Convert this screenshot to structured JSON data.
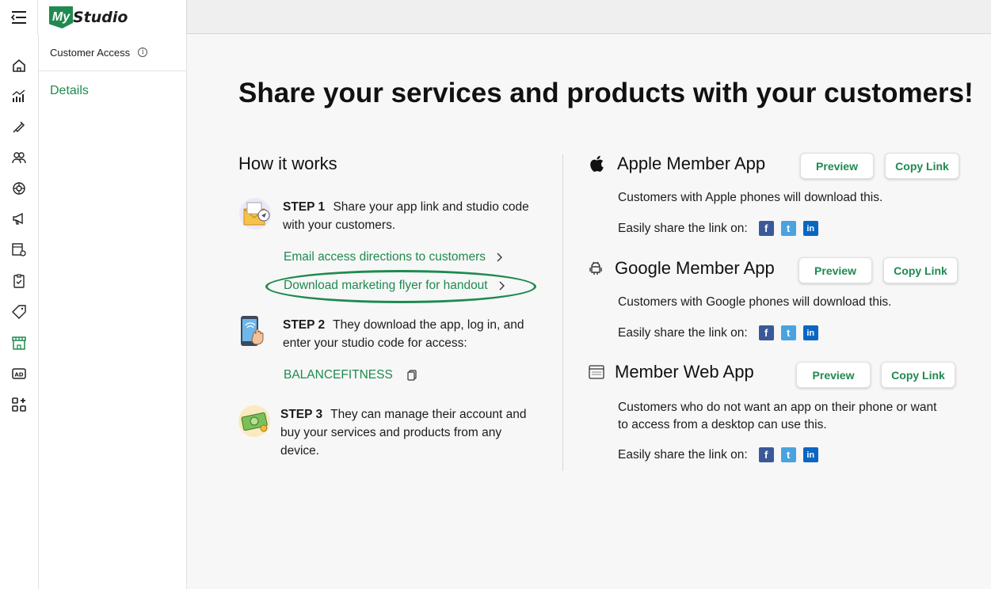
{
  "brand": {
    "logo_mark": "My",
    "logo_text": "Studio",
    "accent": "#1f8a50"
  },
  "rail_icons": [
    "home-icon",
    "analytics-icon",
    "services-icon",
    "customers-icon",
    "network-icon",
    "marketing-icon",
    "schedule-settings-icon",
    "tasks-icon",
    "tag-icon",
    "storefront-icon",
    "ad-icon",
    "add-apps-icon"
  ],
  "subpanel": {
    "header": "Customer Access",
    "info_glyph": "i",
    "items": [
      "Details"
    ]
  },
  "main": {
    "headline": "Share your services and products with your customers!",
    "how_it_works": {
      "title": "How it works",
      "steps": [
        {
          "label": "STEP 1",
          "text": "Share your app link and studio code with your customers."
        },
        {
          "label": "STEP 2",
          "text": "They download the app, log in, and enter your studio code for access:"
        },
        {
          "label": "STEP 3",
          "text": "They can manage their account and buy your services and products from any device."
        }
      ],
      "email_link": "Email access directions to customers",
      "flyer_link": "Download marketing flyer for handout",
      "studio_code": "BALANCEFITNESS"
    },
    "apps": [
      {
        "title": "Apple Member App",
        "desc": "Customers with Apple phones will download this.",
        "preview": "Preview",
        "copy": "Copy Link",
        "share": "Easily share the link on:"
      },
      {
        "title": "Google Member App",
        "desc": "Customers with Google phones will download this.",
        "preview": "Preview",
        "copy": "Copy Link",
        "share": "Easily share the link on:"
      },
      {
        "title": "Member Web App",
        "desc": "Customers who do not want an app on their phone or want to access from a desktop can use this.",
        "preview": "Preview",
        "copy": "Copy Link",
        "share": "Easily share the link on:"
      }
    ],
    "social_glyphs": {
      "facebook": "f",
      "twitter": "t",
      "linkedin": "in"
    }
  }
}
